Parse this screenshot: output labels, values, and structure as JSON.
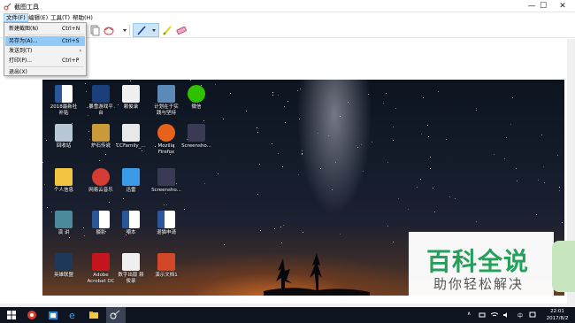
{
  "window": {
    "title": "截图工具",
    "buttons": {
      "minimize": "—",
      "maximize": "☐",
      "close": "✕"
    }
  },
  "menubar": {
    "items": [
      "文件(F)",
      "编辑(E)",
      "工具(T)",
      "帮助(H)"
    ]
  },
  "file_menu": {
    "items": [
      {
        "label": "新建截图(N)",
        "shortcut": "Ctrl+N"
      },
      {
        "label": "另存为(A)...",
        "shortcut": "Ctrl+S"
      },
      {
        "label": "发送到(T)",
        "shortcut": ""
      },
      {
        "label": "打印(P)...",
        "shortcut": "Ctrl+P"
      },
      {
        "label": "退出(X)",
        "shortcut": ""
      }
    ],
    "highlighted": "另存为(A)..."
  },
  "desktop_icons": [
    {
      "label": "2018最新社\n补贴",
      "icon": "word-icon"
    },
    {
      "label": "暴雪游戏平\n台",
      "icon": "battlenet-icon"
    },
    {
      "label": "赖俊录",
      "icon": "document-icon"
    },
    {
      "label": "计划在于实\n践与坚持",
      "icon": "folder-image-icon"
    },
    {
      "label": "微信",
      "icon": "wechat-icon"
    },
    {
      "label": "回收站",
      "icon": "recycle-bin-icon"
    },
    {
      "label": "炉石传说",
      "icon": "hearthstone-icon"
    },
    {
      "label": "CCFamily_...",
      "icon": "file-icon"
    },
    {
      "label": "Mozilla\nFirefox",
      "icon": "firefox-icon"
    },
    {
      "label": "Screensho...",
      "icon": "screenshot-icon"
    },
    {
      "label": "个人信息",
      "icon": "folder-icon"
    },
    {
      "label": "网易云音乐",
      "icon": "netease-music-icon"
    },
    {
      "label": "迅雷",
      "icon": "xunlei-icon"
    },
    {
      "label": "Screensho...",
      "icon": "screenshot-icon"
    },
    {
      "label": "演    讲",
      "icon": "presentation-icon"
    },
    {
      "label": "摄影",
      "icon": "word-icon"
    },
    {
      "label": "嘲本",
      "icon": "word-icon"
    },
    {
      "label": "退猫申请",
      "icon": "word-icon"
    },
    {
      "label": "英雄联盟",
      "icon": "lol-icon"
    },
    {
      "label": "Adobe\nAcrobat DC",
      "icon": "acrobat-icon"
    },
    {
      "label": "数字出版 赖\n俊录",
      "icon": "document-icon"
    },
    {
      "label": "演示文档1",
      "icon": "ppt-icon"
    }
  ],
  "watermark": {
    "big": "百科全说",
    "small": "助你轻松解决"
  },
  "taskbar": {
    "time": "22:01",
    "date": "2017/8/2",
    "ime": "中",
    "tray_arrow": "∧"
  },
  "colors": {
    "menu_highlight": "#91c9f7",
    "watermark_green": "#24a05a",
    "taskbar_bg": "#0e1420"
  }
}
